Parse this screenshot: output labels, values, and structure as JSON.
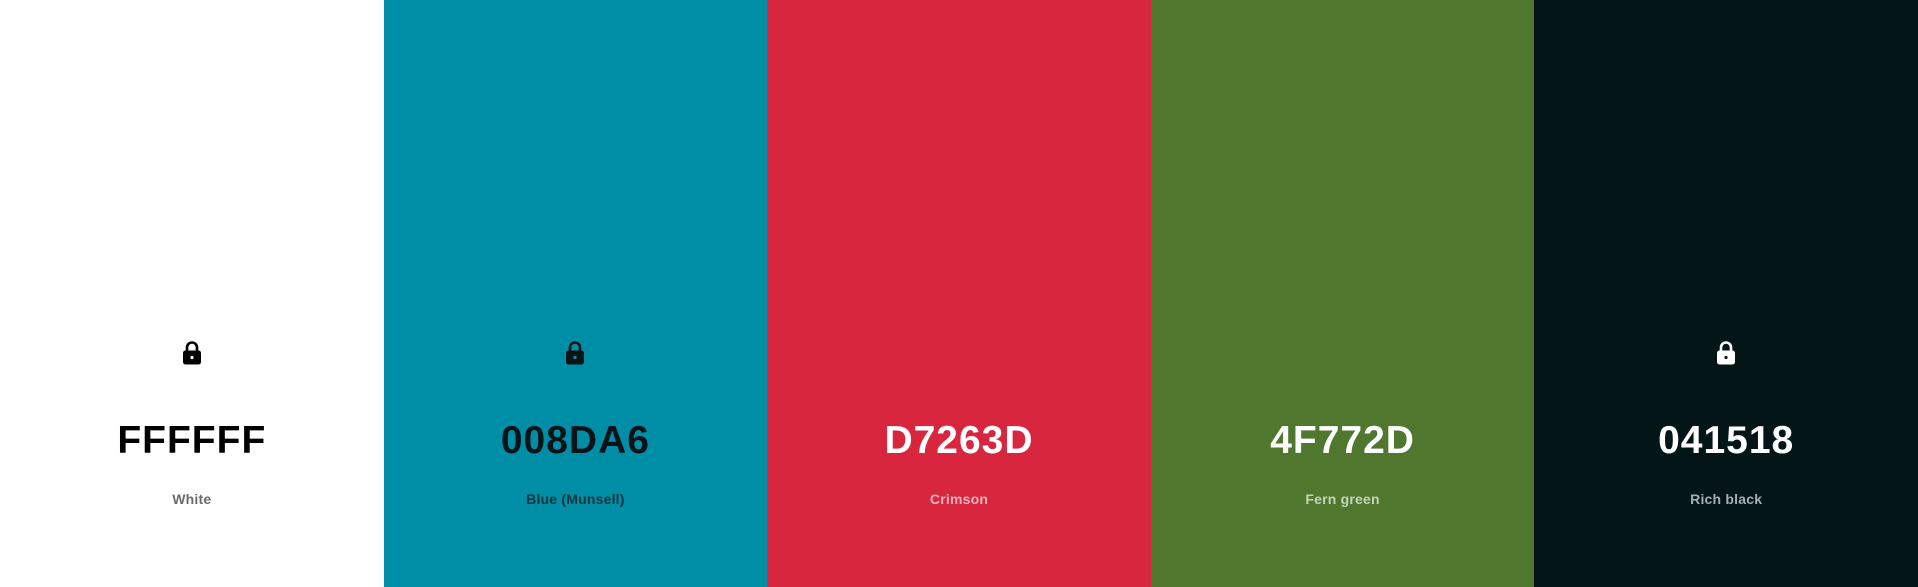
{
  "swatches": [
    {
      "hex": "FFFFFF",
      "name": "White",
      "background": "#ffffff",
      "text_color": "#000000",
      "name_color": "#6b6b6b",
      "lock_icon": "lock-icon",
      "lock_visible": true
    },
    {
      "hex": "008DA6",
      "name": "Blue (Munsell)",
      "background": "#008da6",
      "text_color": "#0a1418",
      "name_color": "#0b3640",
      "lock_icon": "lock-icon",
      "lock_visible": true
    },
    {
      "hex": "D7263D",
      "name": "Crimson",
      "background": "#d7263d",
      "text_color": "#ffffff",
      "name_color": "#efb3bb",
      "lock_icon": "lock-icon",
      "lock_visible": false
    },
    {
      "hex": "4F772D",
      "name": "Fern green",
      "background": "#4f772d",
      "text_color": "#ffffff",
      "name_color": "#c5d3b9",
      "lock_icon": "lock-icon",
      "lock_visible": false
    },
    {
      "hex": "041518",
      "name": "Rich black",
      "background": "#041518",
      "text_color": "#ffffff",
      "name_color": "#a8aeb0",
      "lock_icon": "lock-icon",
      "lock_visible": true
    }
  ]
}
